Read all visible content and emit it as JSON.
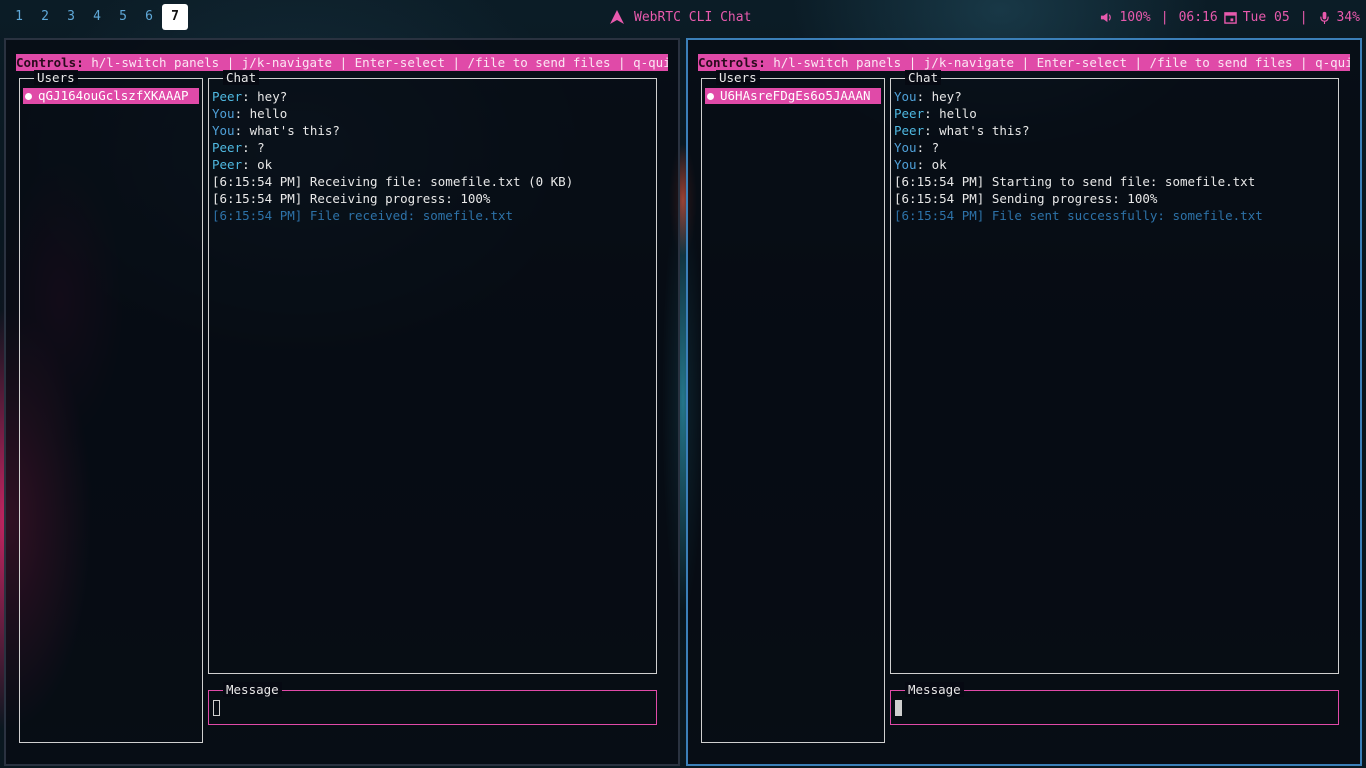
{
  "topbar": {
    "workspaces": [
      "1",
      "2",
      "3",
      "4",
      "5",
      "6",
      "7"
    ],
    "active_workspace": "7",
    "title": "WebRTC CLI Chat",
    "volume": "100%",
    "time": "06:16",
    "date": "Tue 05",
    "mic": "34%",
    "separator": "|"
  },
  "controls": {
    "prefix": "Controls:",
    "text": " h/l-switch panels | j/k-navigate | Enter-select | /file to send files | q-quit"
  },
  "panels": [
    {
      "users_title": "Users",
      "chat_title": "Chat",
      "message_title": "Message",
      "selected_user": "qGJ164ouGclszfXKAAAP",
      "lines": [
        {
          "who": "Peer",
          "text": ": hey?"
        },
        {
          "who": "You",
          "text": ": hello"
        },
        {
          "who": "You",
          "text": ": what's this?"
        },
        {
          "who": "Peer",
          "text": ": ?"
        },
        {
          "who": "Peer",
          "text": ": ok"
        },
        {
          "who": "",
          "text": "[6:15:54 PM] Receiving file: somefile.txt (0 KB)"
        },
        {
          "who": "",
          "text": "[6:15:54 PM] Receiving progress: 100%"
        },
        {
          "who": "",
          "text": "[6:15:54 PM] File received: somefile.txt",
          "style": "info"
        }
      ]
    },
    {
      "users_title": "Users",
      "chat_title": "Chat",
      "message_title": "Message",
      "selected_user": "U6HAsreFDgEs6o5JAAAN",
      "lines": [
        {
          "who": "You",
          "text": ": hey?"
        },
        {
          "who": "Peer",
          "text": ": hello"
        },
        {
          "who": "Peer",
          "text": ": what's this?"
        },
        {
          "who": "You",
          "text": ": ?"
        },
        {
          "who": "You",
          "text": ": ok"
        },
        {
          "who": "",
          "text": "[6:15:54 PM] Starting to send file: somefile.txt"
        },
        {
          "who": "",
          "text": "[6:15:54 PM] Sending progress: 100%"
        },
        {
          "who": "",
          "text": "[6:15:54 PM] File sent successfully: somefile.txt",
          "style": "info"
        }
      ]
    }
  ]
}
